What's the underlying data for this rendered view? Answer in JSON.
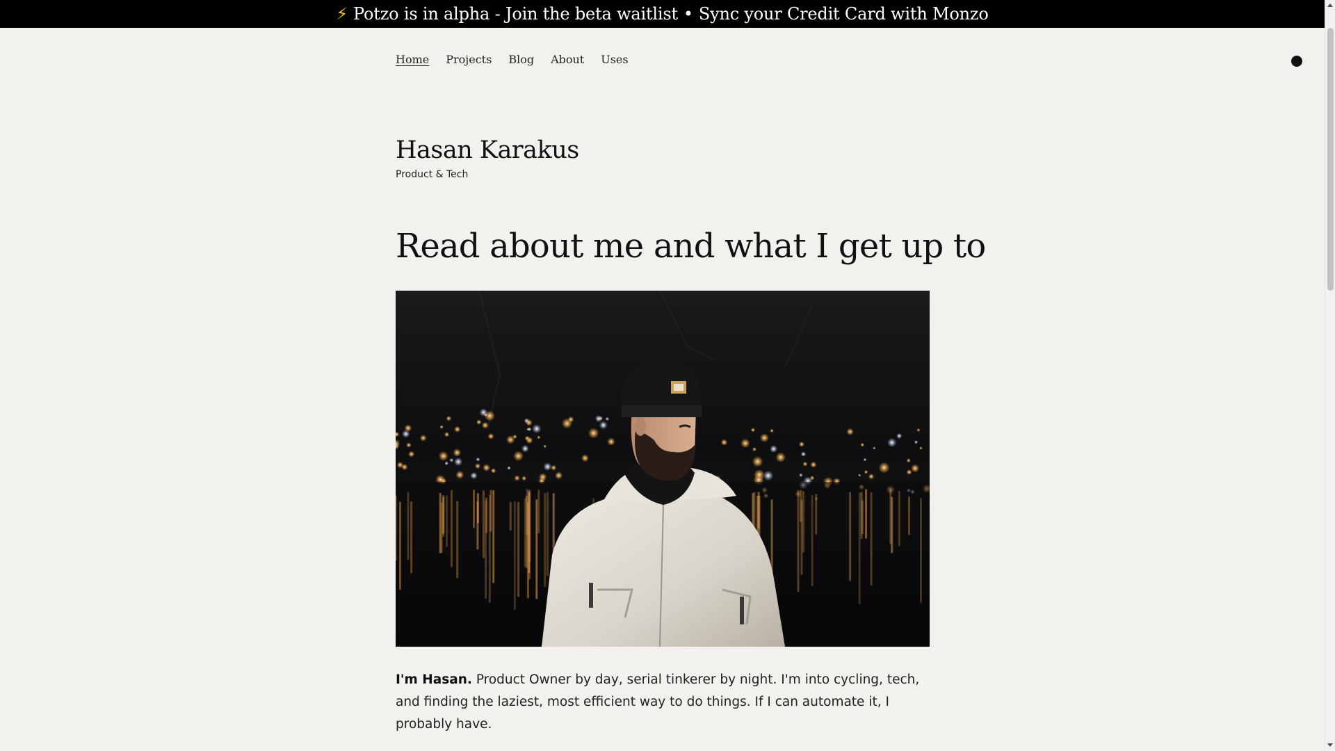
{
  "banner": {
    "icon": "lightning-bolt-icon",
    "icon_glyph": "⚡",
    "text_part1": "Potzo is in alpha - Join the beta waitlist",
    "separator": "•",
    "text_part2": "Sync your Credit Card with Monzo"
  },
  "nav": {
    "items": [
      {
        "label": "Home",
        "active": true
      },
      {
        "label": "Projects",
        "active": false
      },
      {
        "label": "Blog",
        "active": false
      },
      {
        "label": "About",
        "active": false
      },
      {
        "label": "Uses",
        "active": false
      }
    ],
    "theme_toggle_icon": "theme-toggle-circle-icon"
  },
  "header": {
    "name": "Hasan Karakus",
    "tagline": "Product & Tech"
  },
  "main": {
    "heading": "Read about me and what I get up to",
    "photo_icon": "portrait-photo",
    "intro_bold": "I'm Hasan.",
    "intro_text": " Product Owner by day, serial tinkerer by night. I'm into cycling, tech, and finding the laziest, most efficient way to do things. If I can automate it, I probably have."
  },
  "colors": {
    "background": "#f2f1ed",
    "banner_bg": "#000000",
    "banner_text": "#ffffff",
    "text": "#111111"
  }
}
